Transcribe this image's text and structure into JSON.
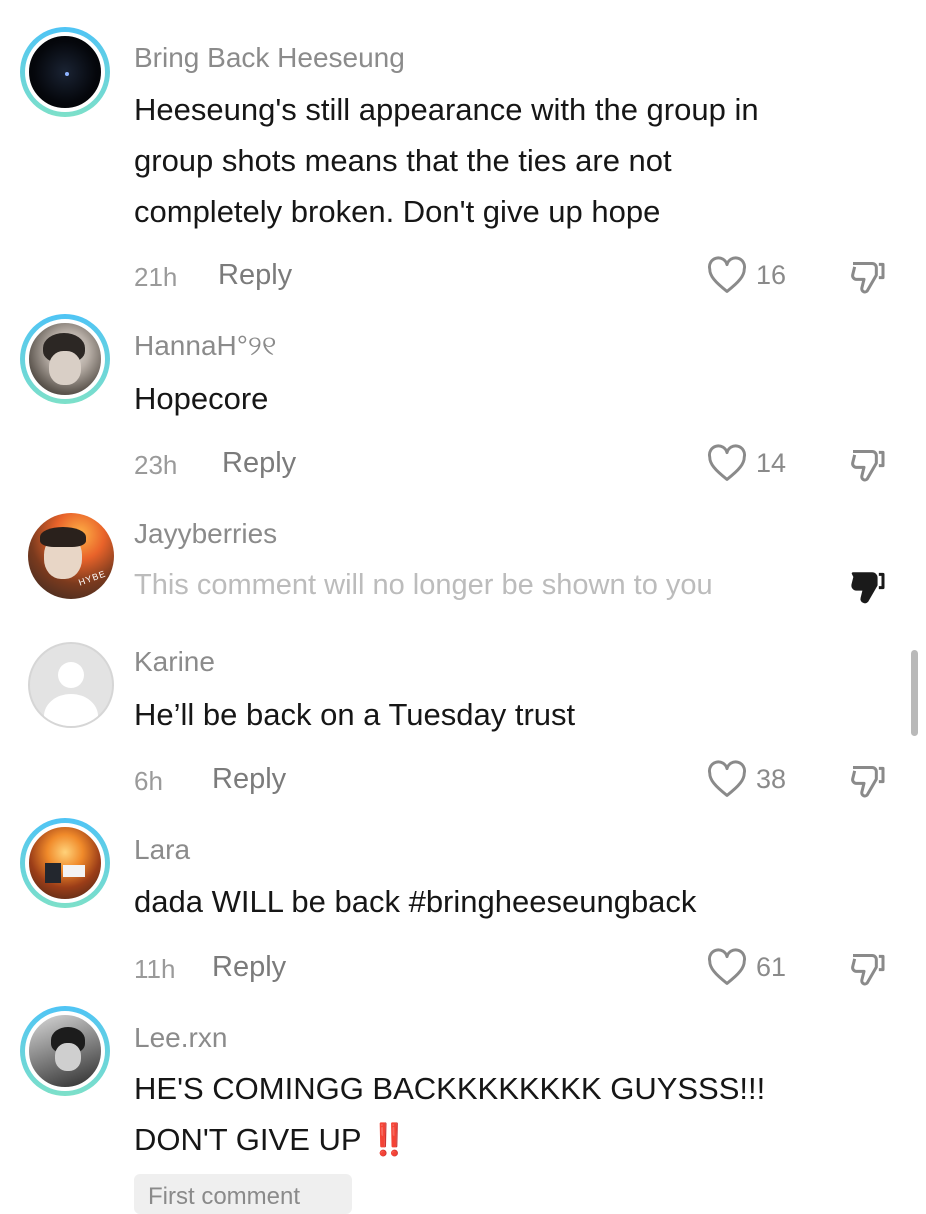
{
  "comments": [
    {
      "username": "Bring Back Heeseung",
      "text": "Heeseung's still appearance with the group in\ngroup shots means that the ties are not\ncompletely broken. Don't give up hope",
      "time": "21h",
      "reply_label": "Reply",
      "likes": "16"
    },
    {
      "username": "HannaH°୨୧",
      "text": "Hopecore",
      "time": "23h",
      "reply_label": "Reply",
      "likes": "14"
    },
    {
      "username": "Jayyberries",
      "text": "This comment will no longer be shown to you",
      "avatar_badge": "HYBE"
    },
    {
      "username": "Karine",
      "text": "He’ll be back on a Tuesday trust",
      "time": "6h",
      "reply_label": "Reply",
      "likes": "38"
    },
    {
      "username": "Lara",
      "text": "dada WILL be back #bringheeseungback",
      "time": "11h",
      "reply_label": "Reply",
      "likes": "61"
    },
    {
      "username": "Lee.rxn",
      "text": "HE'S COMINGG BACKKKKKKKK GUYSSS!!!\nDON'T GIVE UP ",
      "emoji": "‼️",
      "first_comment_label": "First comment"
    }
  ],
  "icons": {
    "like": "heart-outline-icon",
    "dislike": "thumbs-down-outline-icon",
    "dislike_active": "thumbs-down-filled-icon"
  },
  "colors": {
    "avatar_ring_top": "#4fc4f5",
    "avatar_ring_bottom": "#7de0c9",
    "emoji_red": "#e0182d"
  }
}
